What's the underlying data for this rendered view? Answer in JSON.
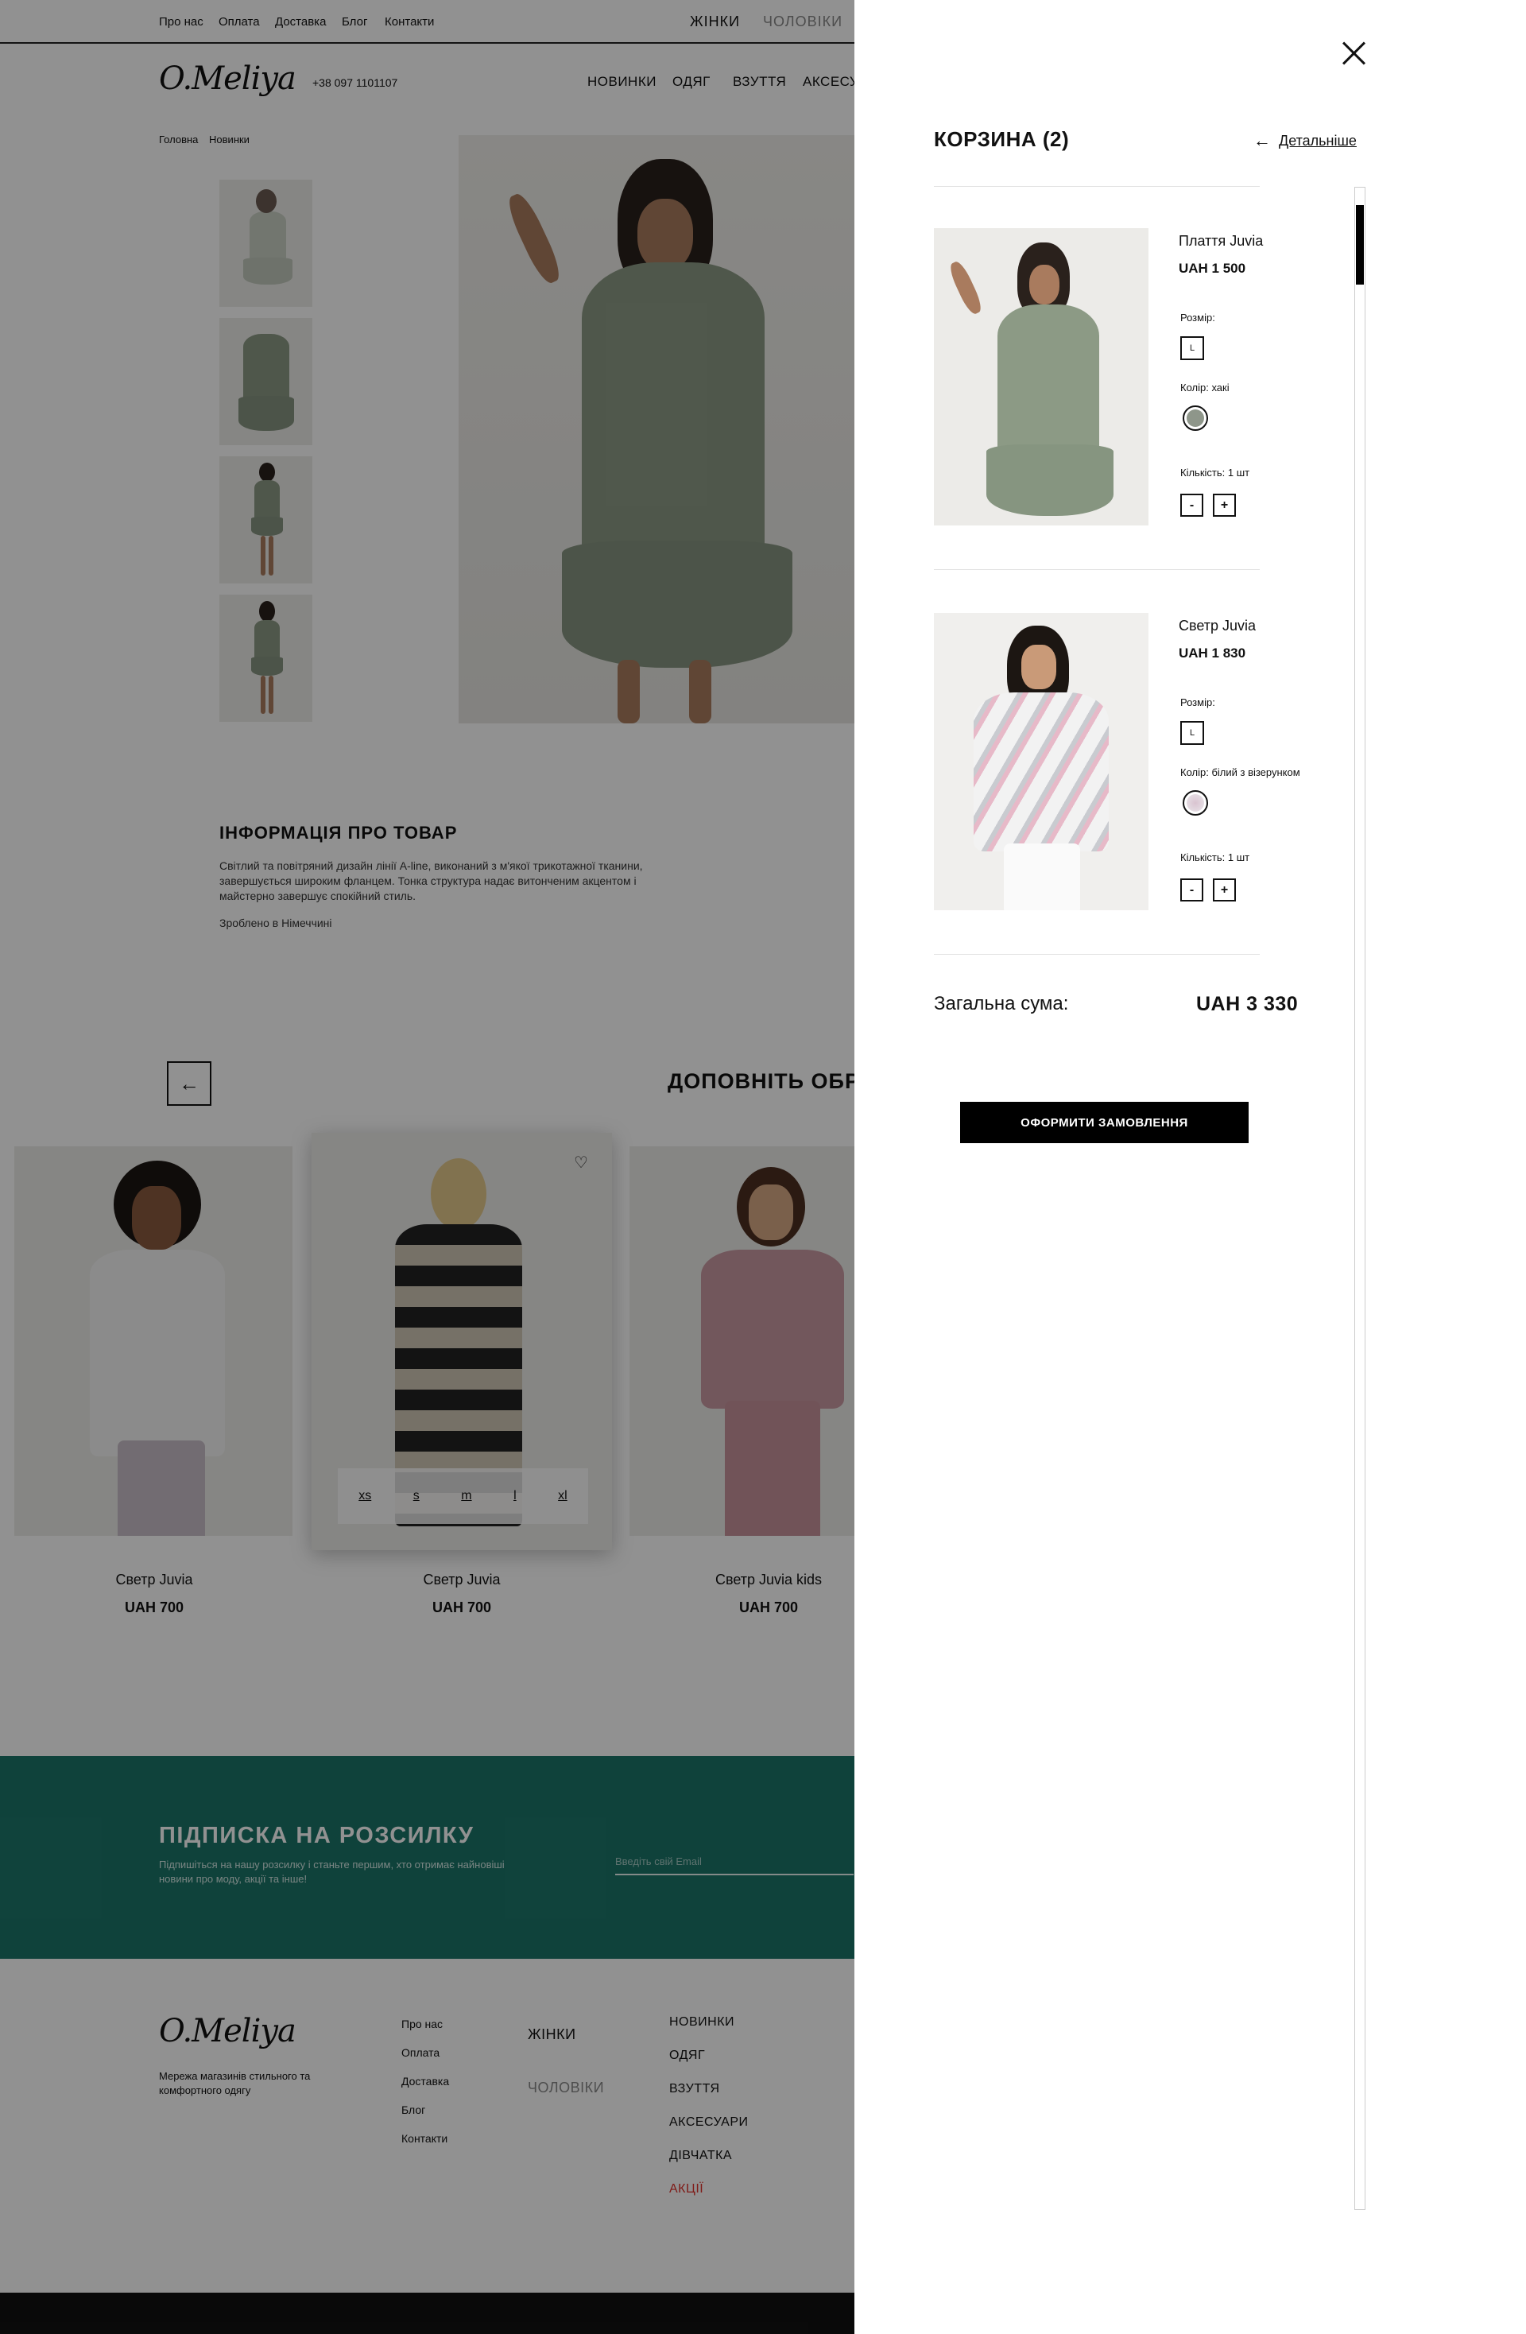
{
  "topbar": {
    "links": [
      "Про нас",
      "Оплата",
      "Доставка",
      "Блог",
      "Контакти"
    ],
    "gender_women": "ЖІНКИ",
    "gender_men": "ЧОЛОВІКИ"
  },
  "header": {
    "logo": "O.Meliya",
    "phone": "+38 097 1101107",
    "nav": [
      "НОВИНКИ",
      "ОДЯГ",
      "ВЗУТТЯ",
      "АКСЕСУА"
    ]
  },
  "breadcrumb": [
    "Головна",
    "Новинки"
  ],
  "product_info": {
    "title": "ІНФОРМАЦІЯ ПРО ТОВАР",
    "description": "Світлий та повітряний дизайн лінії A-line, виконаний з м'якої трикотажної тканини, завершується широким фланцем. Тонка структура надає витонченим акцентом і майстерно завершує спокійний стиль.",
    "made_in": "Зроблено в Німеччині"
  },
  "complete_look": {
    "title": "ДОПОВНІТЬ ОБРА",
    "cards": [
      {
        "name": "Светр Juvia",
        "price": "UAH  700"
      },
      {
        "name": "Светр Juvia",
        "price": "UAH  700"
      },
      {
        "name": "Светр Juvia kids",
        "price": "UAH  700"
      }
    ],
    "sizes": [
      "xs",
      "s",
      "m",
      "l",
      "xl"
    ]
  },
  "subscribe": {
    "title": "ПІДПИСКА НА РОЗСИЛКУ",
    "text": "Підпишіться на нашу розсилку і станьте першим, хто отримає найновіші новини про моду, акції та інше!",
    "placeholder": "Введіть свій Email"
  },
  "footer": {
    "logo": "O.Meliya",
    "tagline": "Мережа магазинів стильного та комфортного одягу",
    "links": [
      "Про нас",
      "Оплата",
      "Доставка",
      "Блог",
      "Контакти"
    ],
    "gender_women": "ЖІНКИ",
    "gender_men": "ЧОЛОВІКИ",
    "categories": [
      "НОВИНКИ",
      "ОДЯГ",
      "ВЗУТТЯ",
      "АКСЕСУАРИ",
      "ДІВЧАТКА",
      "АКЦІЇ"
    ]
  },
  "cart": {
    "title": "КОРЗИНА (2)",
    "more_label": "Детальніше",
    "size_label": "Розмір:",
    "qty_minus": "-",
    "qty_plus": "+",
    "items": [
      {
        "name": "Плаття Juvia",
        "price": "UAH  1 500",
        "size": "L",
        "color_label": "Колір: хакі",
        "color_hex": "#8e968a",
        "qty_label": "Кількість: 1 шт"
      },
      {
        "name": "Светр Juvia",
        "price": "UAH  1 830",
        "size": "L",
        "color_label": "Колір: білий з візерунком",
        "color_hex": "#e9e6ea",
        "qty_label": "Кількість: 1 шт"
      }
    ],
    "total_label": "Загальна сума:",
    "total_value": "UAH  3 330",
    "checkout_label": "ОФОРМИТИ ЗАМОВЛЕННЯ"
  },
  "colors": {
    "accent_teal": "#1c7569",
    "sale_red": "#e0302a",
    "overlay": "rgba(0,0,0,0.43)"
  }
}
